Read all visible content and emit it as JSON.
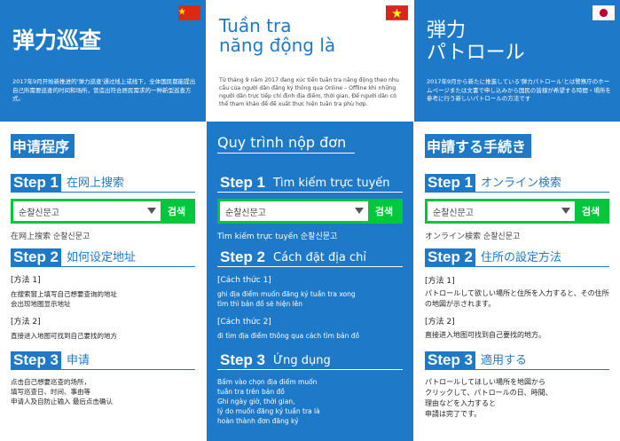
{
  "columns": [
    {
      "lang": "zh",
      "flag": {
        "color": "#de2910",
        "star_color": "#ffde00"
      },
      "title": "弹力巡查",
      "intro": "2017年9月开始新推进的'弹力巡查'通过线上或线下，全体国民都能提出自己所需要巡查的时间和场所，营造出符合居民需求的一种新型巡查方式。",
      "section_title": "申请程序",
      "steps": [
        {
          "badge": "Step 1",
          "name": "在网上搜索"
        },
        {
          "badge": "Step 2",
          "name": "如何设定地址"
        },
        {
          "badge": "Step 3",
          "name": "申请"
        }
      ],
      "search": {
        "value": "순찰신문고",
        "button": "검색"
      },
      "search_caption": "在网上搜索  순찰신문고",
      "method1_label": "[方法 1]",
      "method1_text": "在搜索窗上填写自己想要查询的地址\n会出现地图显示地址",
      "method2_label": "[方法 2]",
      "method2_text": "直接进入地图可找到自己要找的地方",
      "step3_text": "点击自己想要巡查的场所，\n填写巡查日、时间、事由等\n申请人及自防止输入   最后点击确认"
    },
    {
      "lang": "vi",
      "flag": {
        "color": "#da251d",
        "star_color": "#ffff00"
      },
      "title": "Tuần tra\nnăng động là",
      "intro": "Từ tháng 9 năm 2017 đang xúc tiến tuần tra năng động theo nhu cầu của người dân đăng ký thông qua Online – Offline khi những người dân trực tiếp chỉ định địa điểm, thời gian. Để người dân có thể tham khảo để đề xuất thực hiện tuần tra phù hợp.",
      "section_title": "Quy trình nộp đơn",
      "steps": [
        {
          "badge": "Step 1",
          "name": "Tìm kiếm trực tuyến"
        },
        {
          "badge": "Step 2",
          "name": "Cách đặt địa chỉ"
        },
        {
          "badge": "Step 3",
          "name": "Ứng dụng"
        }
      ],
      "search": {
        "value": "순찰신문고",
        "button": "검색"
      },
      "search_caption": "Tìm kiếm trực tuyến  순찰신문고",
      "method1_label": "[Cách thức 1]",
      "method1_text": "ghi địa điểm muốn đăng ký tuần tra xong\ntìm thì bản đồ sẽ hiện lên",
      "method2_label": "[Cách thức 2]",
      "method2_text": "đi tìm địa điểm thông qua cách tìm bản đồ",
      "step3_text": "Bấm vào chọn địa điểm muốn\ntuần tra trên bản đồ\nGhi ngày giờ, thời gian,\nlý do muốn đăng ký tuần tra là\nhoàn thành đơn đăng ký"
    },
    {
      "lang": "ja",
      "flag": {
        "color": "#ffffff",
        "dot_color": "#bc002d"
      },
      "title": "弾力\nパトロール",
      "intro": "2017年9月から新たに推進している'弾力パトロール'とは警察庁のホームページまたは文書で申し込みから国民の皆様が希望する時間・場所を参考に行う新しいパトロールの方法です",
      "section_title": "申請する手続き",
      "steps": [
        {
          "badge": "Step 1",
          "name": "オンライン検索"
        },
        {
          "badge": "Step 2",
          "name": "住所の設定方法"
        },
        {
          "badge": "Step 3",
          "name": "適用する"
        }
      ],
      "search": {
        "value": "순찰신문고",
        "button": "검색"
      },
      "search_caption": "オンライン検索  순찰신문고",
      "method1_label": "[方法 1]",
      "method1_text": "パトロールして欲しい場所と住所を入力すると、その住所の地図が示されます。",
      "method2_label": "[方法 2]",
      "method2_text": "直接进入地图可找到自己要找的地方。",
      "step3_text": "パトロールしてほしい場所を地図から\nクリックして、パトロールの日、時間、\n理由などを入力すると\n申請は完了です。"
    }
  ]
}
